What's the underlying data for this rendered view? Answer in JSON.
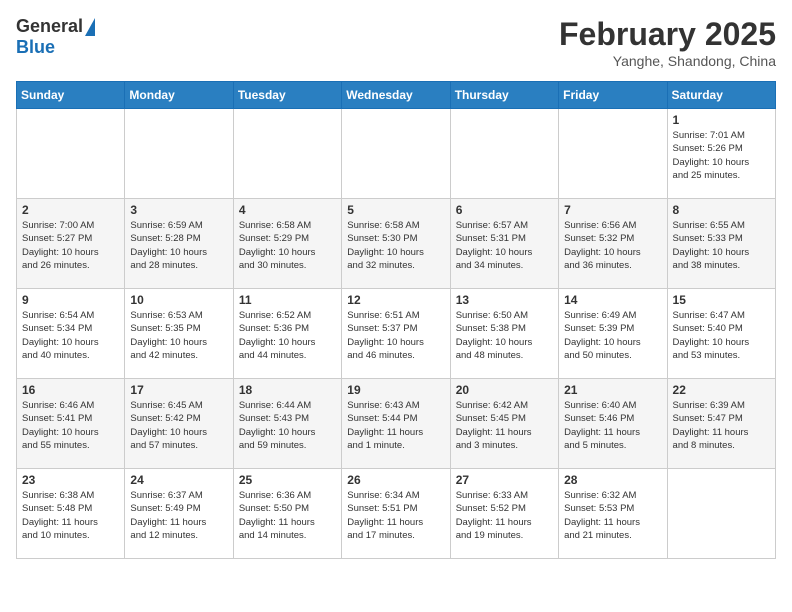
{
  "header": {
    "logo_general": "General",
    "logo_blue": "Blue",
    "month_title": "February 2025",
    "location": "Yanghe, Shandong, China"
  },
  "weekdays": [
    "Sunday",
    "Monday",
    "Tuesday",
    "Wednesday",
    "Thursday",
    "Friday",
    "Saturday"
  ],
  "weeks": [
    [
      {
        "day": "",
        "info": ""
      },
      {
        "day": "",
        "info": ""
      },
      {
        "day": "",
        "info": ""
      },
      {
        "day": "",
        "info": ""
      },
      {
        "day": "",
        "info": ""
      },
      {
        "day": "",
        "info": ""
      },
      {
        "day": "1",
        "info": "Sunrise: 7:01 AM\nSunset: 5:26 PM\nDaylight: 10 hours\nand 25 minutes."
      }
    ],
    [
      {
        "day": "2",
        "info": "Sunrise: 7:00 AM\nSunset: 5:27 PM\nDaylight: 10 hours\nand 26 minutes."
      },
      {
        "day": "3",
        "info": "Sunrise: 6:59 AM\nSunset: 5:28 PM\nDaylight: 10 hours\nand 28 minutes."
      },
      {
        "day": "4",
        "info": "Sunrise: 6:58 AM\nSunset: 5:29 PM\nDaylight: 10 hours\nand 30 minutes."
      },
      {
        "day": "5",
        "info": "Sunrise: 6:58 AM\nSunset: 5:30 PM\nDaylight: 10 hours\nand 32 minutes."
      },
      {
        "day": "6",
        "info": "Sunrise: 6:57 AM\nSunset: 5:31 PM\nDaylight: 10 hours\nand 34 minutes."
      },
      {
        "day": "7",
        "info": "Sunrise: 6:56 AM\nSunset: 5:32 PM\nDaylight: 10 hours\nand 36 minutes."
      },
      {
        "day": "8",
        "info": "Sunrise: 6:55 AM\nSunset: 5:33 PM\nDaylight: 10 hours\nand 38 minutes."
      }
    ],
    [
      {
        "day": "9",
        "info": "Sunrise: 6:54 AM\nSunset: 5:34 PM\nDaylight: 10 hours\nand 40 minutes."
      },
      {
        "day": "10",
        "info": "Sunrise: 6:53 AM\nSunset: 5:35 PM\nDaylight: 10 hours\nand 42 minutes."
      },
      {
        "day": "11",
        "info": "Sunrise: 6:52 AM\nSunset: 5:36 PM\nDaylight: 10 hours\nand 44 minutes."
      },
      {
        "day": "12",
        "info": "Sunrise: 6:51 AM\nSunset: 5:37 PM\nDaylight: 10 hours\nand 46 minutes."
      },
      {
        "day": "13",
        "info": "Sunrise: 6:50 AM\nSunset: 5:38 PM\nDaylight: 10 hours\nand 48 minutes."
      },
      {
        "day": "14",
        "info": "Sunrise: 6:49 AM\nSunset: 5:39 PM\nDaylight: 10 hours\nand 50 minutes."
      },
      {
        "day": "15",
        "info": "Sunrise: 6:47 AM\nSunset: 5:40 PM\nDaylight: 10 hours\nand 53 minutes."
      }
    ],
    [
      {
        "day": "16",
        "info": "Sunrise: 6:46 AM\nSunset: 5:41 PM\nDaylight: 10 hours\nand 55 minutes."
      },
      {
        "day": "17",
        "info": "Sunrise: 6:45 AM\nSunset: 5:42 PM\nDaylight: 10 hours\nand 57 minutes."
      },
      {
        "day": "18",
        "info": "Sunrise: 6:44 AM\nSunset: 5:43 PM\nDaylight: 10 hours\nand 59 minutes."
      },
      {
        "day": "19",
        "info": "Sunrise: 6:43 AM\nSunset: 5:44 PM\nDaylight: 11 hours\nand 1 minute."
      },
      {
        "day": "20",
        "info": "Sunrise: 6:42 AM\nSunset: 5:45 PM\nDaylight: 11 hours\nand 3 minutes."
      },
      {
        "day": "21",
        "info": "Sunrise: 6:40 AM\nSunset: 5:46 PM\nDaylight: 11 hours\nand 5 minutes."
      },
      {
        "day": "22",
        "info": "Sunrise: 6:39 AM\nSunset: 5:47 PM\nDaylight: 11 hours\nand 8 minutes."
      }
    ],
    [
      {
        "day": "23",
        "info": "Sunrise: 6:38 AM\nSunset: 5:48 PM\nDaylight: 11 hours\nand 10 minutes."
      },
      {
        "day": "24",
        "info": "Sunrise: 6:37 AM\nSunset: 5:49 PM\nDaylight: 11 hours\nand 12 minutes."
      },
      {
        "day": "25",
        "info": "Sunrise: 6:36 AM\nSunset: 5:50 PM\nDaylight: 11 hours\nand 14 minutes."
      },
      {
        "day": "26",
        "info": "Sunrise: 6:34 AM\nSunset: 5:51 PM\nDaylight: 11 hours\nand 17 minutes."
      },
      {
        "day": "27",
        "info": "Sunrise: 6:33 AM\nSunset: 5:52 PM\nDaylight: 11 hours\nand 19 minutes."
      },
      {
        "day": "28",
        "info": "Sunrise: 6:32 AM\nSunset: 5:53 PM\nDaylight: 11 hours\nand 21 minutes."
      },
      {
        "day": "",
        "info": ""
      }
    ]
  ]
}
